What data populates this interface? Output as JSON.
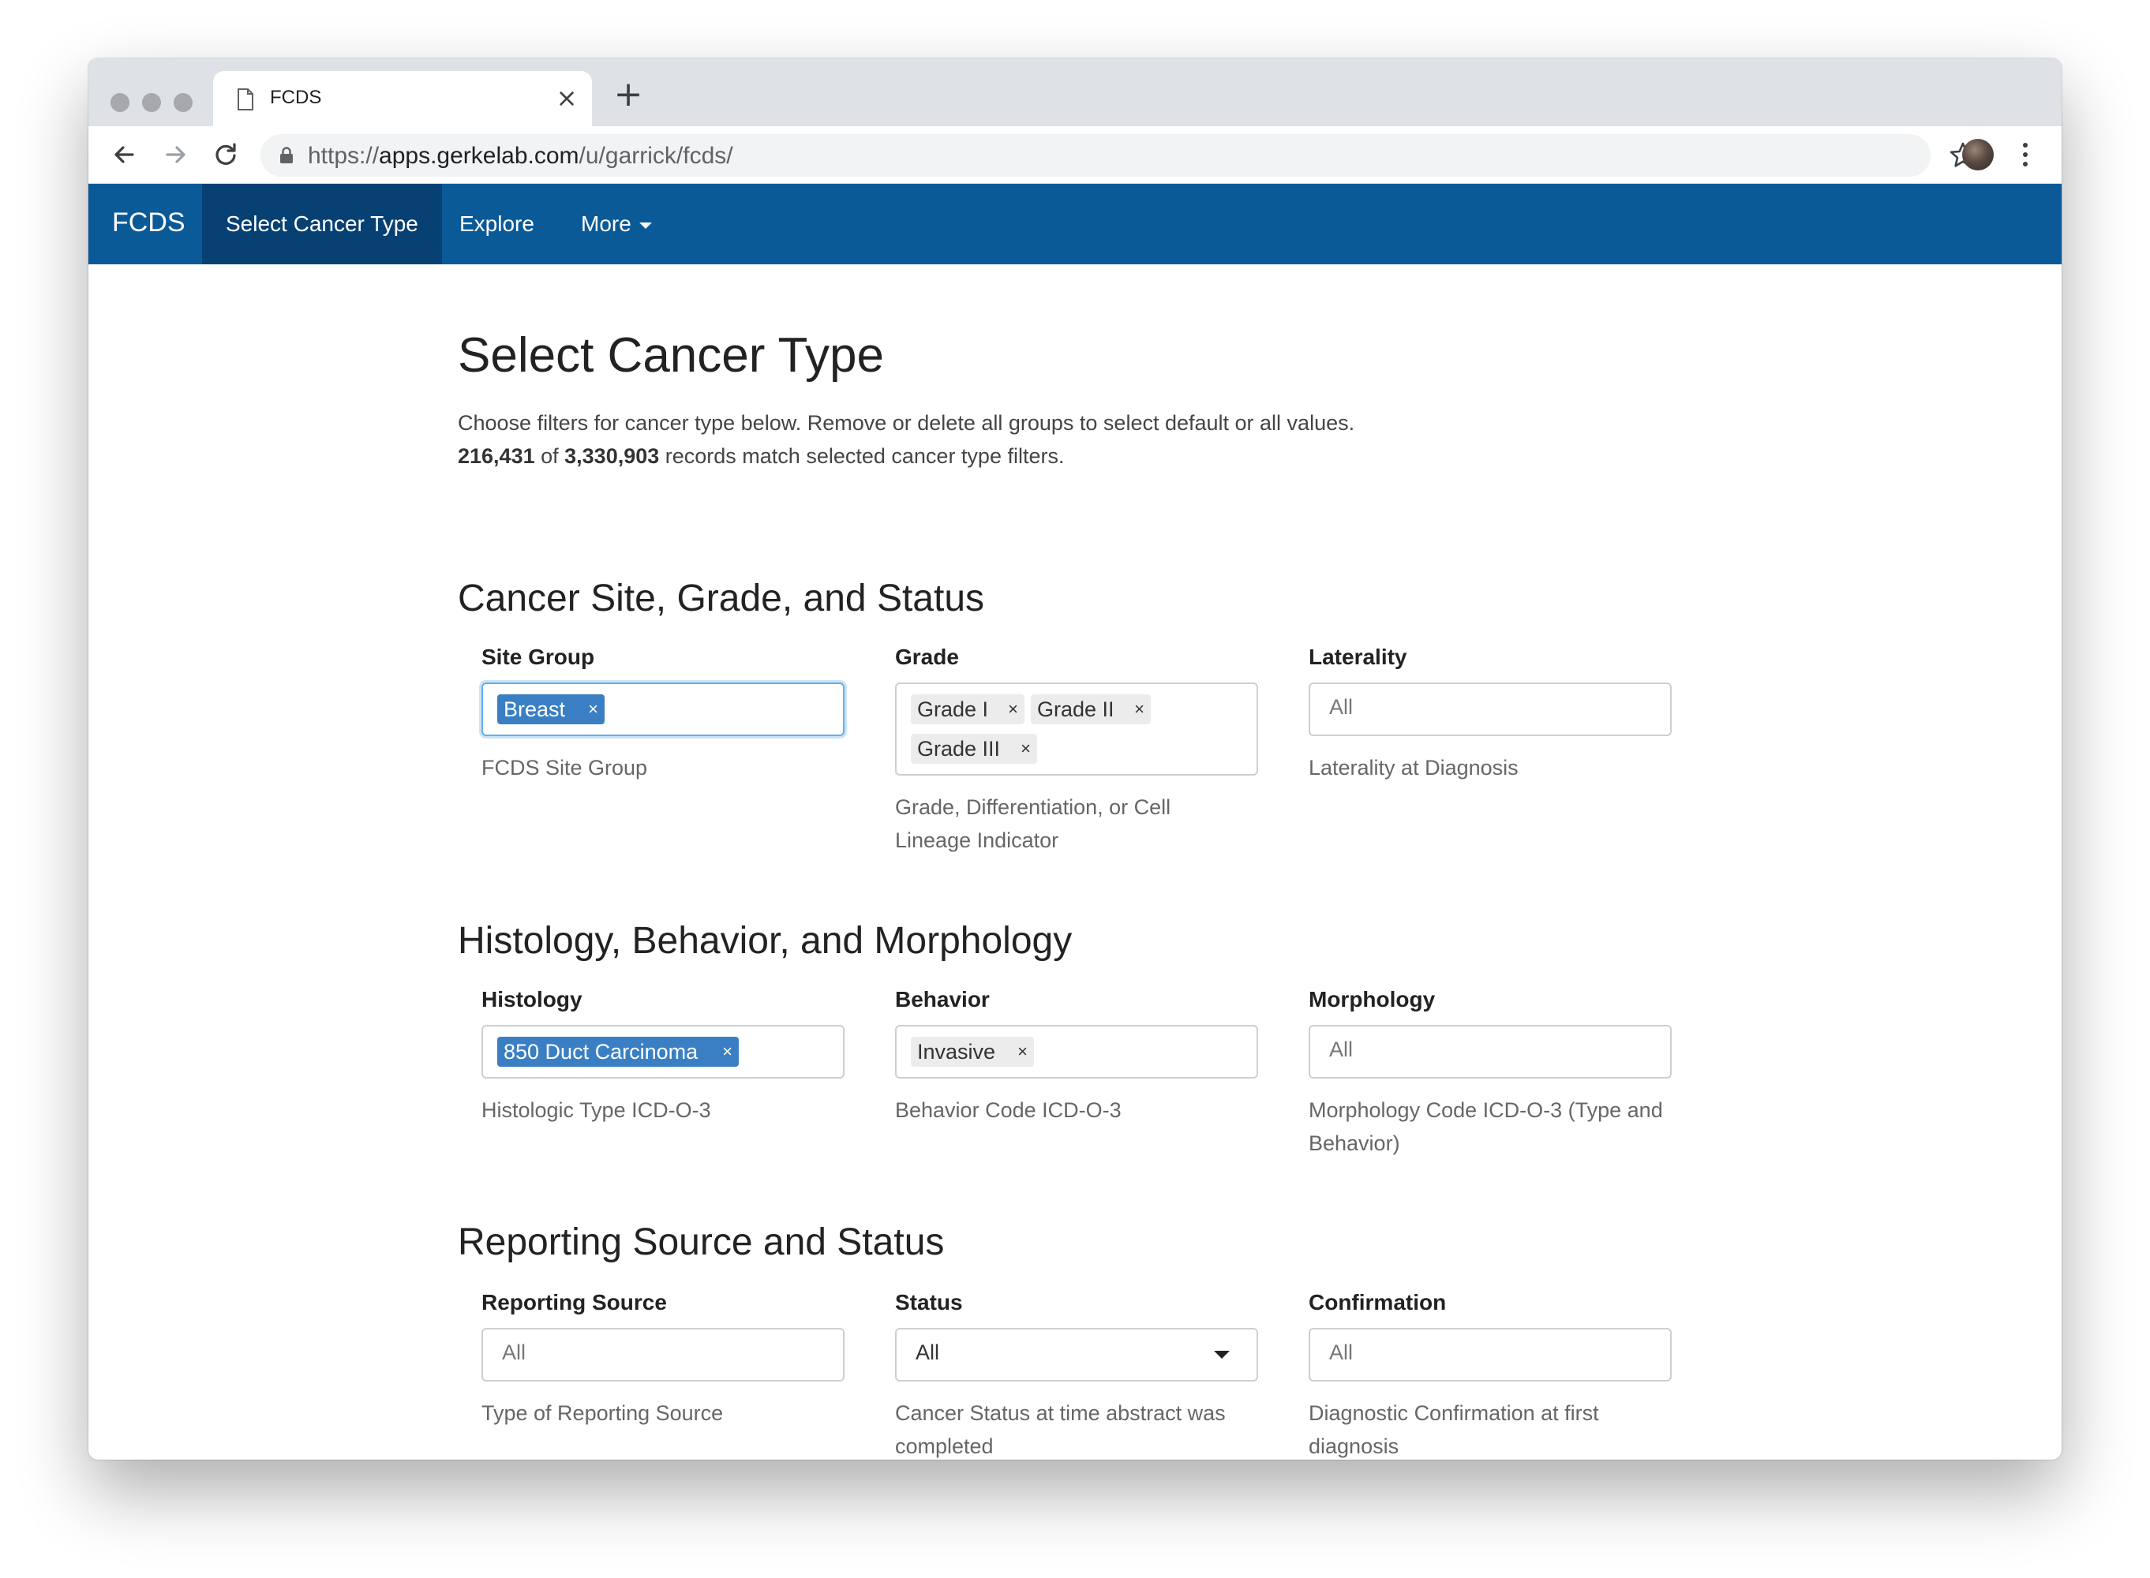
{
  "browser": {
    "tab_title": "FCDS",
    "tab_close": "×",
    "new_tab": "+",
    "url_scheme": "https://",
    "url_host": "apps.gerkelab.com",
    "url_path": "/u/garrick/fcds/"
  },
  "navbar": {
    "brand": "FCDS",
    "items": [
      {
        "label": "Select Cancer Type"
      },
      {
        "label": "Explore"
      },
      {
        "label": "More"
      }
    ],
    "color": "#0a5a98",
    "active_color": "#074173"
  },
  "page": {
    "title": "Select Cancer Type",
    "description": "Choose filters for cancer type below. Remove or delete all groups to select default or all values.",
    "records_matched": "216,431",
    "records_of": " of ",
    "records_total": "3,330,903",
    "records_suffix": " records match selected cancer type filters."
  },
  "sections": {
    "site": {
      "title": "Cancer Site, Grade, and Status",
      "site_group": {
        "label": "Site Group",
        "chips": [
          "Breast"
        ],
        "help": "FCDS Site Group"
      },
      "grade": {
        "label": "Grade",
        "chips": [
          "Grade I",
          "Grade II",
          "Grade III"
        ],
        "help_line1": "Grade, Differentiation, or Cell",
        "help_line2": "Lineage Indicator"
      },
      "laterality": {
        "label": "Laterality",
        "placeholder": "All",
        "help": "Laterality at Diagnosis"
      }
    },
    "histology": {
      "title": "Histology, Behavior, and Morphology",
      "histology": {
        "label": "Histology",
        "chips": [
          "850 Duct Carcinoma"
        ],
        "help": "Histologic Type ICD-O-3"
      },
      "behavior": {
        "label": "Behavior",
        "chips": [
          "Invasive"
        ],
        "help": "Behavior Code ICD-O-3"
      },
      "morphology": {
        "label": "Morphology",
        "placeholder": "All",
        "help_line1": "Morphology Code ICD-O-3 (Type and",
        "help_line2": "Behavior)"
      }
    },
    "reporting": {
      "title": "Reporting Source and Status",
      "reporting_source": {
        "label": "Reporting Source",
        "placeholder": "All",
        "help": "Type of Reporting Source"
      },
      "status": {
        "label": "Status",
        "value": "All",
        "help_line1": "Cancer Status at time abstract was",
        "help_line2": "completed"
      },
      "confirmation": {
        "label": "Confirmation",
        "placeholder": "All",
        "help_line1": "Diagnostic Confirmation at first",
        "help_line2": "diagnosis"
      }
    }
  },
  "chip_remove": "×"
}
